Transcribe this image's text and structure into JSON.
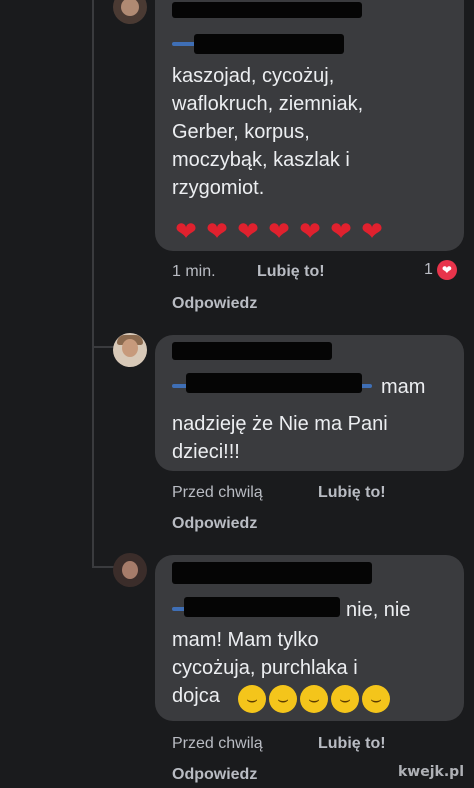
{
  "comments": [
    {
      "lines": [
        "kaszojad, cycożuj,",
        "waflokruch, ziemniak,",
        "Gerber, korpus,",
        "moczybąk, kaszlak i",
        "rzygomiot."
      ],
      "emoji": [
        "heart",
        "heart",
        "heart",
        "heart",
        "heart",
        "heart",
        "heart"
      ],
      "time": "1 min.",
      "like": "Lubię to!",
      "reply": "Odpowiedz",
      "reaction_count": "1"
    },
    {
      "lines": [
        "mam",
        "nadzieję  że Nie ma Pani",
        "dzieci!!!"
      ],
      "time": "Przed chwilą",
      "like": "Lubię to!",
      "reply": "Odpowiedz"
    },
    {
      "lines": [
        "nie, nie",
        "mam! Mam tylko",
        "cycożuja, purchlaka i",
        "dojca"
      ],
      "emoji": [
        "laugh",
        "laugh",
        "laugh",
        "laugh",
        "laugh"
      ],
      "time": "Przed chwilą",
      "like": "Lubię to!",
      "reply": "Odpowiedz"
    }
  ],
  "watermark": "kwejk.pl",
  "colors": {
    "background": "#1a1b1d",
    "bubble": "#3a3b3e",
    "heart": "#e0212e",
    "laugh": "#f4c51b",
    "tag": "#3f6fb6"
  }
}
